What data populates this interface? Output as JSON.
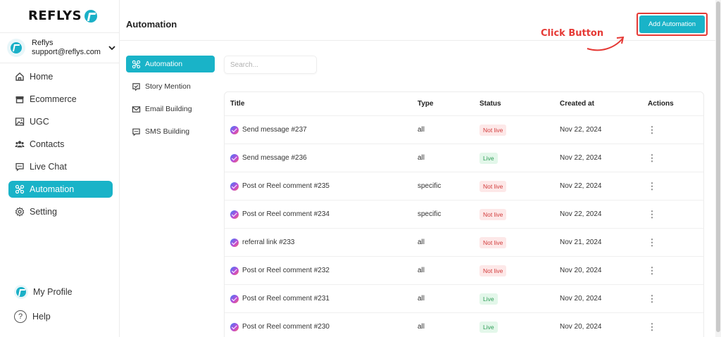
{
  "brand": {
    "name": "REFLYS",
    "accent": "#19b3c8"
  },
  "account": {
    "name": "Reflys",
    "email": "support@reflys.com"
  },
  "nav": [
    {
      "label": "Home",
      "icon": "home-icon"
    },
    {
      "label": "Ecommerce",
      "icon": "store-icon"
    },
    {
      "label": "UGC",
      "icon": "image-icon"
    },
    {
      "label": "Contacts",
      "icon": "users-icon"
    },
    {
      "label": "Live Chat",
      "icon": "chat-icon"
    },
    {
      "label": "Automation",
      "icon": "automation-icon",
      "active": true
    },
    {
      "label": "Setting",
      "icon": "gear-icon"
    }
  ],
  "footer": {
    "profile": "My Profile",
    "help": "Help"
  },
  "header": {
    "title": "Automation",
    "add_button": "Add Automation",
    "annotation": "Click Button",
    "annotation_color": "#e53935"
  },
  "subnav": [
    {
      "label": "Automation",
      "icon": "automation-icon",
      "active": true
    },
    {
      "label": "Story Mention",
      "icon": "story-icon"
    },
    {
      "label": "Email Building",
      "icon": "mail-icon"
    },
    {
      "label": "SMS Building",
      "icon": "sms-icon"
    }
  ],
  "search": {
    "placeholder": "Search..."
  },
  "table": {
    "columns": [
      "Title",
      "Type",
      "Status",
      "Created at",
      "Actions"
    ],
    "rows": [
      {
        "title": "Send message #237",
        "type": "all",
        "status": "Not live",
        "created": "Nov 22, 2024"
      },
      {
        "title": "Send message #236",
        "type": "all",
        "status": "Live",
        "created": "Nov 22, 2024"
      },
      {
        "title": "Post or Reel comment #235",
        "type": "specific",
        "status": "Not live",
        "created": "Nov 22, 2024"
      },
      {
        "title": "Post or Reel comment #234",
        "type": "specific",
        "status": "Not live",
        "created": "Nov 22, 2024"
      },
      {
        "title": "referral link #233",
        "type": "all",
        "status": "Not live",
        "created": "Nov 21, 2024"
      },
      {
        "title": "Post or Reel comment #232",
        "type": "all",
        "status": "Not live",
        "created": "Nov 20, 2024"
      },
      {
        "title": "Post or Reel comment #231",
        "type": "all",
        "status": "Live",
        "created": "Nov 20, 2024"
      },
      {
        "title": "Post or Reel comment #230",
        "type": "all",
        "status": "Live",
        "created": "Nov 20, 2024"
      }
    ]
  }
}
